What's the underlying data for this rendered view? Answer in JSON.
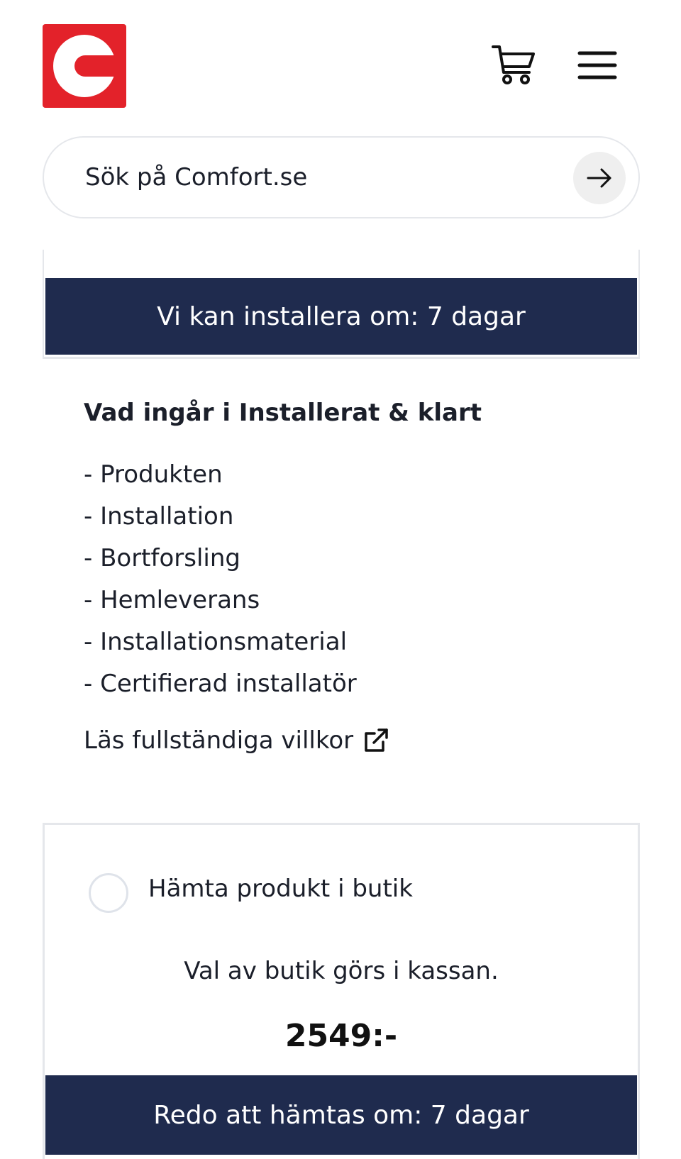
{
  "header": {
    "logo_icon": "comfort-logo",
    "brand_color": "#e3222a",
    "cart_icon": "cart-icon",
    "menu_icon": "hamburger-menu-icon"
  },
  "search": {
    "placeholder": "Sök på Comfort.se",
    "submit_icon": "arrow-right-icon"
  },
  "installation_option": {
    "availability": "Vi kan installera om: 7 dagar",
    "bar_color": "#1f2b4e"
  },
  "includes": {
    "title": "Vad ingår i Installerat & klart",
    "items": [
      "- Produkten",
      "- Installation",
      "- Bortforsling",
      "- Hemleverans",
      "- Installationsmaterial",
      "- Certifierad installatör"
    ],
    "terms_link": "Läs fullständiga villkor",
    "terms_icon": "external-link-icon"
  },
  "pickup_option": {
    "label": "Hämta produkt i butik",
    "note": "Val av butik görs i kassan.",
    "price": "2549:-",
    "availability": "Redo att hämtas om: 7 dagar"
  }
}
